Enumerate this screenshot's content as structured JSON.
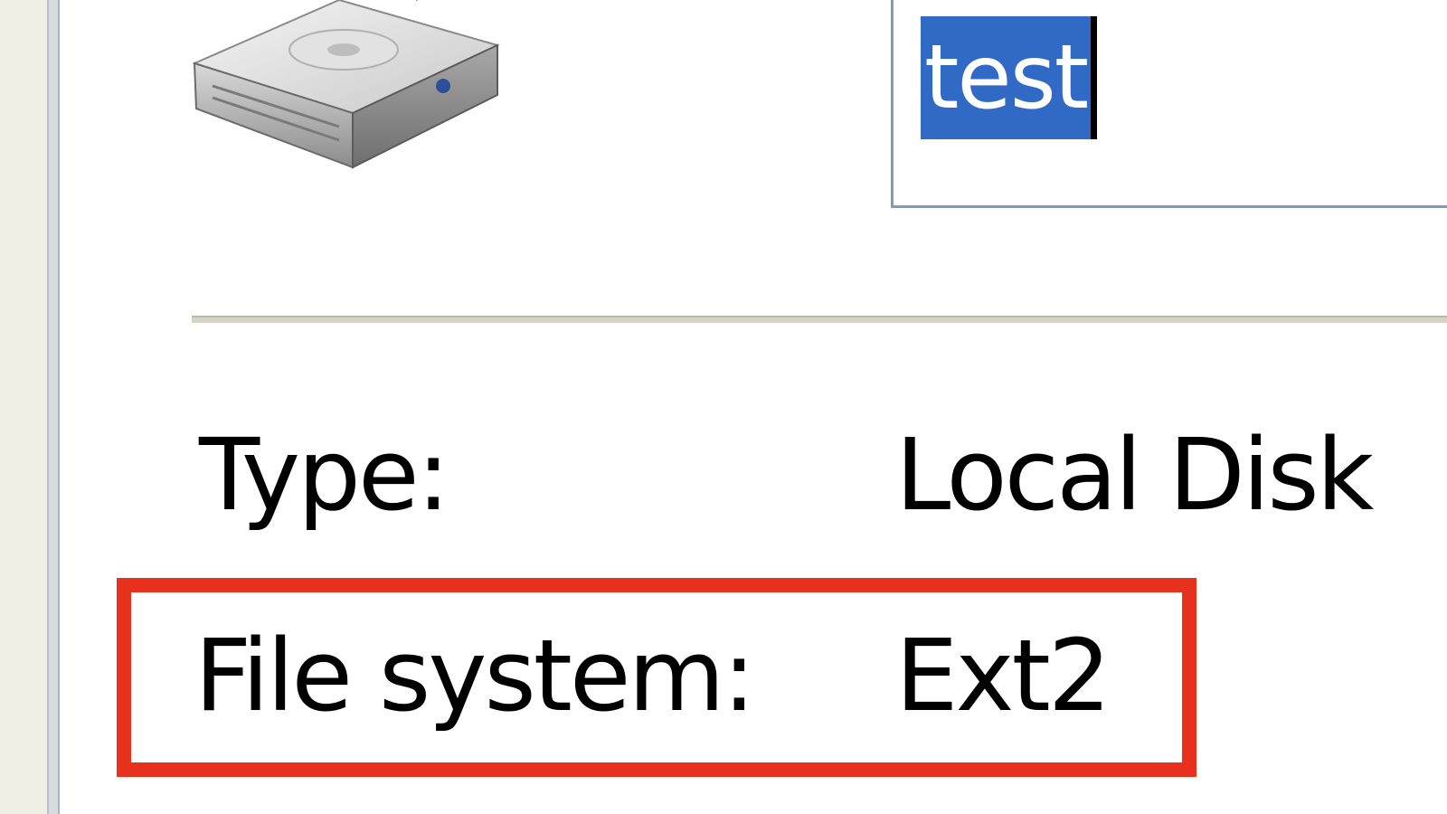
{
  "drive_name": {
    "value": "test"
  },
  "properties": {
    "type": {
      "label": "Type:",
      "value": "Local Disk"
    },
    "file_system": {
      "label": "File system:",
      "value": "Ext2"
    }
  },
  "colors": {
    "selection": "#316ac5",
    "highlight_box": "#e8311d",
    "field_border": "#7f9db9",
    "separator": "#d6d3c6"
  },
  "icons": {
    "drive": "hard-drive-icon"
  }
}
